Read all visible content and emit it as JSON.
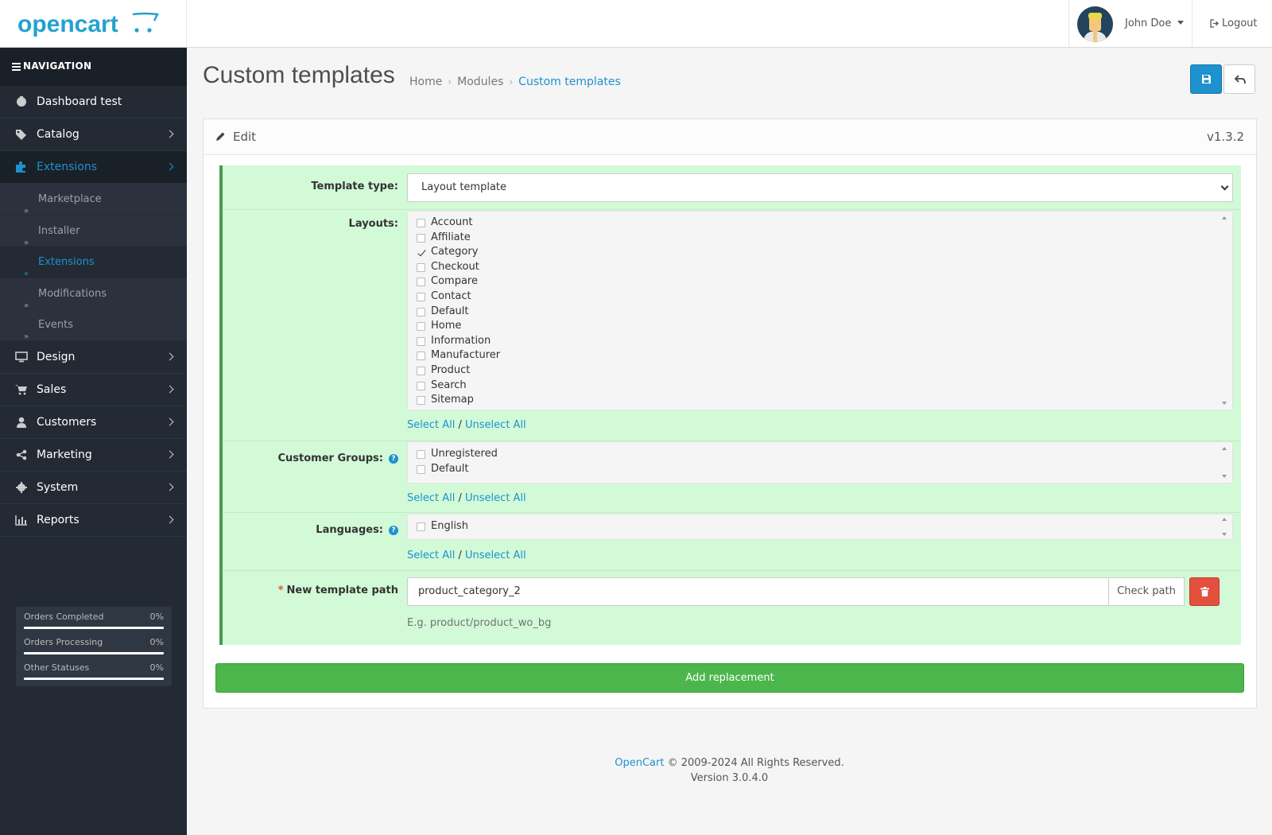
{
  "header": {
    "logo_text": "opencart",
    "user_name": "John Doe",
    "logout_label": "Logout"
  },
  "sidebar": {
    "nav_title": "NAVIGATION",
    "items": [
      {
        "label": "Dashboard test",
        "icon": "dashboard-icon"
      },
      {
        "label": "Catalog",
        "icon": "tags-icon"
      },
      {
        "label": "Extensions",
        "icon": "puzzle-icon"
      },
      {
        "label": "Design",
        "icon": "monitor-icon"
      },
      {
        "label": "Sales",
        "icon": "cart-icon"
      },
      {
        "label": "Customers",
        "icon": "user-icon"
      },
      {
        "label": "Marketing",
        "icon": "share-icon"
      },
      {
        "label": "System",
        "icon": "gear-icon"
      },
      {
        "label": "Reports",
        "icon": "bar-chart-icon"
      }
    ],
    "extensions_sub": [
      {
        "label": "Marketplace"
      },
      {
        "label": "Installer"
      },
      {
        "label": "Extensions"
      },
      {
        "label": "Modifications"
      },
      {
        "label": "Events"
      }
    ],
    "stats": [
      {
        "label": "Orders Completed",
        "value": "0%"
      },
      {
        "label": "Orders Processing",
        "value": "0%"
      },
      {
        "label": "Other Statuses",
        "value": "0%"
      }
    ]
  },
  "page": {
    "title": "Custom templates",
    "breadcrumb": [
      "Home",
      "Modules",
      "Custom templates"
    ]
  },
  "panel": {
    "title": "Edit",
    "version": "v1.3.2"
  },
  "form": {
    "template_type_label": "Template type:",
    "template_type_value": "Layout template",
    "layouts_label": "Layouts:",
    "layouts": [
      {
        "label": "Account",
        "checked": false
      },
      {
        "label": "Affiliate",
        "checked": false
      },
      {
        "label": "Category",
        "checked": true
      },
      {
        "label": "Checkout",
        "checked": false
      },
      {
        "label": "Compare",
        "checked": false
      },
      {
        "label": "Contact",
        "checked": false
      },
      {
        "label": "Default",
        "checked": false
      },
      {
        "label": "Home",
        "checked": false
      },
      {
        "label": "Information",
        "checked": false
      },
      {
        "label": "Manufacturer",
        "checked": false
      },
      {
        "label": "Product",
        "checked": false
      },
      {
        "label": "Search",
        "checked": false
      },
      {
        "label": "Sitemap",
        "checked": false
      }
    ],
    "customer_groups_label": "Customer Groups:",
    "customer_groups": [
      {
        "label": "Unregistered",
        "checked": false
      },
      {
        "label": "Default",
        "checked": false
      }
    ],
    "languages_label": "Languages:",
    "languages": [
      {
        "label": "English",
        "checked": false
      }
    ],
    "select_all": "Select All",
    "separator": "/",
    "unselect_all": "Unselect All",
    "help_glyph": "?",
    "required_mark": "*",
    "path_label": "New template path",
    "path_value": "product_category_2",
    "check_path": "Check path",
    "path_hint": "E.g. product/product_wo_bg",
    "add_replacement": "Add replacement"
  },
  "footer": {
    "brand": "OpenCart",
    "copyright": "© 2009-2024 All Rights Reserved.",
    "version": "Version 3.0.4.0"
  },
  "colors": {
    "accent": "#1e91cf",
    "sidebar_bg": "#232a33",
    "form_bg": "#d2fad7",
    "success": "#4cb64c",
    "danger": "#e3503e"
  }
}
